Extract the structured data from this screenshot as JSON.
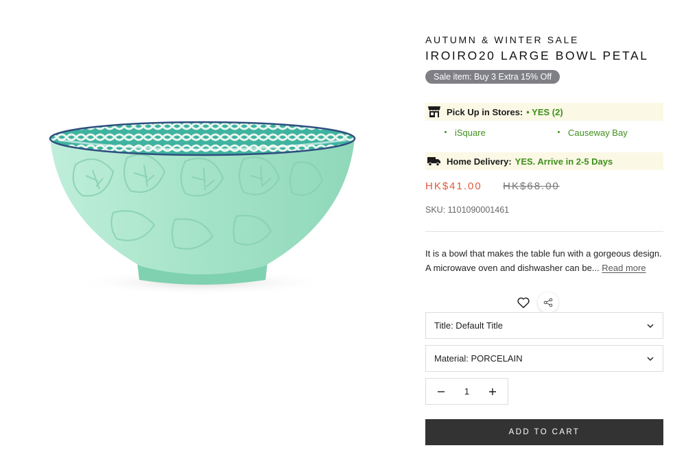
{
  "product": {
    "image_alt": "Mint green embossed leaf bowl with teal patterned interior",
    "collection": "AUTUMN & WINTER SALE",
    "title": "IROIRO20 LARGE BOWL PETAL",
    "sale_badge": "Sale item: Buy 3 Extra 15% Off",
    "pickup": {
      "label": "Pick Up in Stores:",
      "value": "• YES (2)",
      "stores": [
        "iSquare",
        "Causeway Bay"
      ]
    },
    "delivery": {
      "label": "Home Delivery:",
      "value": "YES. Arrive in 2-5 Days"
    },
    "price": "HK$41.00",
    "compare_price": "HK$68.00",
    "sku": "SKU: 1101090001461",
    "description": "It is a bowl that makes the table fun with a gorgeous design. A microwave oven and dishwasher can be...",
    "read_more": "Read more",
    "options": [
      {
        "label": "Title: Default Title"
      },
      {
        "label": "Material: PORCELAIN"
      }
    ],
    "quantity": "1",
    "add_to_cart": "ADD TO CART"
  },
  "icons": {
    "store": "store-icon",
    "truck": "truck-icon",
    "wishlist": "heart-icon",
    "share": "share-icon",
    "chevron": "chevron-down-icon",
    "minus": "minus-icon",
    "plus": "plus-icon"
  },
  "colors": {
    "accent_price": "#e0593f",
    "stock_green": "#3f8f1c",
    "stock_bg": "#fbf8e6",
    "badge_bg": "#7f7f86",
    "button_bg": "#333333",
    "bowl_body": "#a6e3c8",
    "bowl_interior": "#46b7a3"
  }
}
